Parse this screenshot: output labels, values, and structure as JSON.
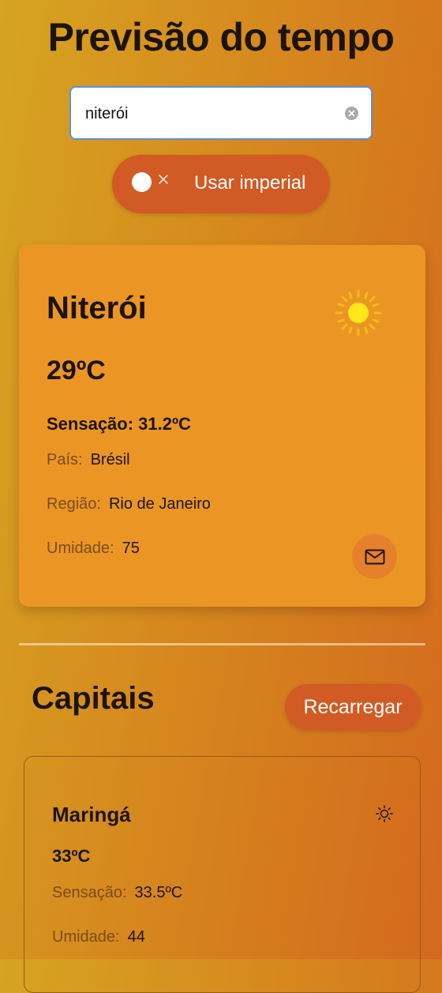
{
  "header": {
    "title": "Previsão do tempo"
  },
  "search": {
    "value": "niterói",
    "clear_icon": "clear-circle-icon"
  },
  "units_toggle": {
    "label": "Usar imperial",
    "checked": false
  },
  "current_weather": {
    "city": "Niterói",
    "icon": "sun-icon",
    "temperature": "29ºC",
    "feels_like": "Sensação: 31.2ºC",
    "country_label": "País",
    "country": "Brésil",
    "region_label": "Região",
    "region": "Rio de Janeiro",
    "humidity_label": "Umidade",
    "humidity": "75",
    "mail_icon": "mail-icon"
  },
  "capitals": {
    "title": "Capitais",
    "reload_label": "Recarregar",
    "items": [
      {
        "city": "Maringá",
        "icon": "sun-outline-icon",
        "temperature": "33ºC",
        "feels_label": "Sensação",
        "feels_like": "33.5ºC",
        "humidity_label": "Umidade",
        "humidity": "44"
      }
    ]
  },
  "colors": {
    "accent": "#d25a24",
    "card": "#eb9624",
    "text": "#1c130b"
  }
}
